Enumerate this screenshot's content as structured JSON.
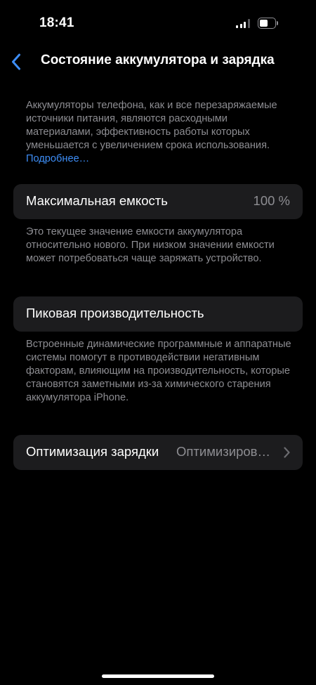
{
  "status_bar": {
    "time": "18:41",
    "signal_bars_filled": 3,
    "signal_bars_total": 4,
    "battery_level": 0.4
  },
  "nav": {
    "back_icon": "chevron-left-icon",
    "title": "Состояние аккумулятора и зарядка",
    "accent_color": "#3e8ef7"
  },
  "intro": {
    "text": "Аккумуляторы телефона, как и все перезаряжаемые источники питания, являются расходными материалами, эффективность работы которых уменьшается с увеличением срока использования.",
    "link": "Подробнее…"
  },
  "max_capacity": {
    "label": "Максимальная емкость",
    "value": "100 %",
    "description": "Это текущее значение емкости аккумулятора относительно нового. При низком значении емкости может потребоваться чаще заряжать устройство."
  },
  "peak_performance": {
    "label": "Пиковая производительность",
    "description": "Встроенные динамические программные и аппаратные системы помогут в противодействии негативным факторам, влияющим на производительность, которые становятся заметными из-за химического старения аккумулятора iPhone."
  },
  "charging_optimization": {
    "label": "Оптимизация зарядки",
    "value": "Оптимизиров…",
    "chevron_icon": "chevron-right-icon"
  }
}
